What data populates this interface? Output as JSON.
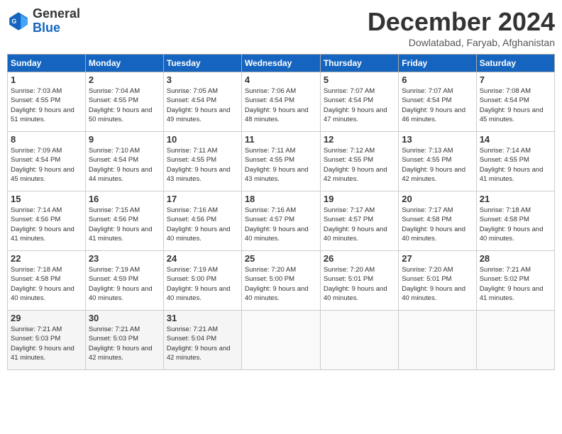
{
  "header": {
    "logo": {
      "line1": "General",
      "line2": "Blue"
    },
    "title": "December 2024",
    "subtitle": "Dowlatabad, Faryab, Afghanistan"
  },
  "weekdays": [
    "Sunday",
    "Monday",
    "Tuesday",
    "Wednesday",
    "Thursday",
    "Friday",
    "Saturday"
  ],
  "weeks": [
    [
      {
        "day": "1",
        "sunrise": "Sunrise: 7:03 AM",
        "sunset": "Sunset: 4:55 PM",
        "daylight": "Daylight: 9 hours and 51 minutes."
      },
      {
        "day": "2",
        "sunrise": "Sunrise: 7:04 AM",
        "sunset": "Sunset: 4:55 PM",
        "daylight": "Daylight: 9 hours and 50 minutes."
      },
      {
        "day": "3",
        "sunrise": "Sunrise: 7:05 AM",
        "sunset": "Sunset: 4:54 PM",
        "daylight": "Daylight: 9 hours and 49 minutes."
      },
      {
        "day": "4",
        "sunrise": "Sunrise: 7:06 AM",
        "sunset": "Sunset: 4:54 PM",
        "daylight": "Daylight: 9 hours and 48 minutes."
      },
      {
        "day": "5",
        "sunrise": "Sunrise: 7:07 AM",
        "sunset": "Sunset: 4:54 PM",
        "daylight": "Daylight: 9 hours and 47 minutes."
      },
      {
        "day": "6",
        "sunrise": "Sunrise: 7:07 AM",
        "sunset": "Sunset: 4:54 PM",
        "daylight": "Daylight: 9 hours and 46 minutes."
      },
      {
        "day": "7",
        "sunrise": "Sunrise: 7:08 AM",
        "sunset": "Sunset: 4:54 PM",
        "daylight": "Daylight: 9 hours and 45 minutes."
      }
    ],
    [
      {
        "day": "8",
        "sunrise": "Sunrise: 7:09 AM",
        "sunset": "Sunset: 4:54 PM",
        "daylight": "Daylight: 9 hours and 45 minutes."
      },
      {
        "day": "9",
        "sunrise": "Sunrise: 7:10 AM",
        "sunset": "Sunset: 4:54 PM",
        "daylight": "Daylight: 9 hours and 44 minutes."
      },
      {
        "day": "10",
        "sunrise": "Sunrise: 7:11 AM",
        "sunset": "Sunset: 4:55 PM",
        "daylight": "Daylight: 9 hours and 43 minutes."
      },
      {
        "day": "11",
        "sunrise": "Sunrise: 7:11 AM",
        "sunset": "Sunset: 4:55 PM",
        "daylight": "Daylight: 9 hours and 43 minutes."
      },
      {
        "day": "12",
        "sunrise": "Sunrise: 7:12 AM",
        "sunset": "Sunset: 4:55 PM",
        "daylight": "Daylight: 9 hours and 42 minutes."
      },
      {
        "day": "13",
        "sunrise": "Sunrise: 7:13 AM",
        "sunset": "Sunset: 4:55 PM",
        "daylight": "Daylight: 9 hours and 42 minutes."
      },
      {
        "day": "14",
        "sunrise": "Sunrise: 7:14 AM",
        "sunset": "Sunset: 4:55 PM",
        "daylight": "Daylight: 9 hours and 41 minutes."
      }
    ],
    [
      {
        "day": "15",
        "sunrise": "Sunrise: 7:14 AM",
        "sunset": "Sunset: 4:56 PM",
        "daylight": "Daylight: 9 hours and 41 minutes."
      },
      {
        "day": "16",
        "sunrise": "Sunrise: 7:15 AM",
        "sunset": "Sunset: 4:56 PM",
        "daylight": "Daylight: 9 hours and 41 minutes."
      },
      {
        "day": "17",
        "sunrise": "Sunrise: 7:16 AM",
        "sunset": "Sunset: 4:56 PM",
        "daylight": "Daylight: 9 hours and 40 minutes."
      },
      {
        "day": "18",
        "sunrise": "Sunrise: 7:16 AM",
        "sunset": "Sunset: 4:57 PM",
        "daylight": "Daylight: 9 hours and 40 minutes."
      },
      {
        "day": "19",
        "sunrise": "Sunrise: 7:17 AM",
        "sunset": "Sunset: 4:57 PM",
        "daylight": "Daylight: 9 hours and 40 minutes."
      },
      {
        "day": "20",
        "sunrise": "Sunrise: 7:17 AM",
        "sunset": "Sunset: 4:58 PM",
        "daylight": "Daylight: 9 hours and 40 minutes."
      },
      {
        "day": "21",
        "sunrise": "Sunrise: 7:18 AM",
        "sunset": "Sunset: 4:58 PM",
        "daylight": "Daylight: 9 hours and 40 minutes."
      }
    ],
    [
      {
        "day": "22",
        "sunrise": "Sunrise: 7:18 AM",
        "sunset": "Sunset: 4:58 PM",
        "daylight": "Daylight: 9 hours and 40 minutes."
      },
      {
        "day": "23",
        "sunrise": "Sunrise: 7:19 AM",
        "sunset": "Sunset: 4:59 PM",
        "daylight": "Daylight: 9 hours and 40 minutes."
      },
      {
        "day": "24",
        "sunrise": "Sunrise: 7:19 AM",
        "sunset": "Sunset: 5:00 PM",
        "daylight": "Daylight: 9 hours and 40 minutes."
      },
      {
        "day": "25",
        "sunrise": "Sunrise: 7:20 AM",
        "sunset": "Sunset: 5:00 PM",
        "daylight": "Daylight: 9 hours and 40 minutes."
      },
      {
        "day": "26",
        "sunrise": "Sunrise: 7:20 AM",
        "sunset": "Sunset: 5:01 PM",
        "daylight": "Daylight: 9 hours and 40 minutes."
      },
      {
        "day": "27",
        "sunrise": "Sunrise: 7:20 AM",
        "sunset": "Sunset: 5:01 PM",
        "daylight": "Daylight: 9 hours and 40 minutes."
      },
      {
        "day": "28",
        "sunrise": "Sunrise: 7:21 AM",
        "sunset": "Sunset: 5:02 PM",
        "daylight": "Daylight: 9 hours and 41 minutes."
      }
    ],
    [
      {
        "day": "29",
        "sunrise": "Sunrise: 7:21 AM",
        "sunset": "Sunset: 5:03 PM",
        "daylight": "Daylight: 9 hours and 41 minutes."
      },
      {
        "day": "30",
        "sunrise": "Sunrise: 7:21 AM",
        "sunset": "Sunset: 5:03 PM",
        "daylight": "Daylight: 9 hours and 42 minutes."
      },
      {
        "day": "31",
        "sunrise": "Sunrise: 7:21 AM",
        "sunset": "Sunset: 5:04 PM",
        "daylight": "Daylight: 9 hours and 42 minutes."
      },
      null,
      null,
      null,
      null
    ]
  ]
}
